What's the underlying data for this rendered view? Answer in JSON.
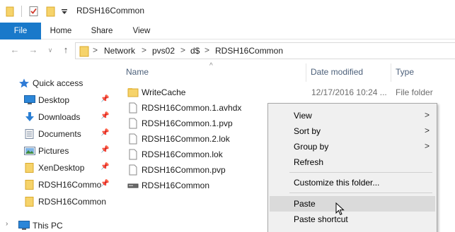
{
  "window": {
    "title": "RDSH16Common"
  },
  "ribbon": {
    "tabs": [
      "File",
      "Home",
      "Share",
      "View"
    ]
  },
  "address": {
    "path": [
      "Network",
      "pvs02",
      "d$",
      "RDSH16Common"
    ],
    "separator": ">"
  },
  "nav": {
    "quick_access": "Quick access",
    "items": [
      {
        "label": "Desktop",
        "icon": "desktop-icon",
        "pinned": true
      },
      {
        "label": "Downloads",
        "icon": "downloads-icon",
        "pinned": true
      },
      {
        "label": "Documents",
        "icon": "documents-icon",
        "pinned": true
      },
      {
        "label": "Pictures",
        "icon": "pictures-icon",
        "pinned": true
      },
      {
        "label": "XenDesktop",
        "icon": "folder-icon",
        "pinned": true
      },
      {
        "label": "RDSH16Commo",
        "icon": "folder-icon",
        "pinned": true
      },
      {
        "label": "RDSH16Common",
        "icon": "folder-icon",
        "pinned": false
      }
    ],
    "this_pc": "This PC"
  },
  "table": {
    "columns": [
      "Name",
      "Date modified",
      "Type"
    ],
    "rows": [
      {
        "name": "WriteCache",
        "icon": "folder-icon",
        "date": "12/17/2016 10:24 ...",
        "type": "File folder"
      },
      {
        "name": "RDSH16Common.1.avhdx",
        "icon": "file-icon",
        "date": "",
        "type": ""
      },
      {
        "name": "RDSH16Common.1.pvp",
        "icon": "file-icon",
        "date": "",
        "type": ""
      },
      {
        "name": "RDSH16Common.2.lok",
        "icon": "file-icon",
        "date": "",
        "type": ""
      },
      {
        "name": "RDSH16Common.lok",
        "icon": "file-icon",
        "date": "",
        "type": ""
      },
      {
        "name": "RDSH16Common.pvp",
        "icon": "file-icon",
        "date": "",
        "type": ""
      },
      {
        "name": "RDSH16Common",
        "icon": "disk-icon",
        "date": "",
        "type": ""
      }
    ]
  },
  "context_menu": {
    "items": [
      "View",
      "Sort by",
      "Group by",
      "Refresh",
      "Customize this folder...",
      "Paste",
      "Paste shortcut"
    ],
    "submenu_arrow": ">"
  },
  "colors": {
    "accent": "#1979ca",
    "folder": "#f6d36a",
    "menu_bg": "#f0f0f0",
    "menu_hover": "#dadada"
  }
}
